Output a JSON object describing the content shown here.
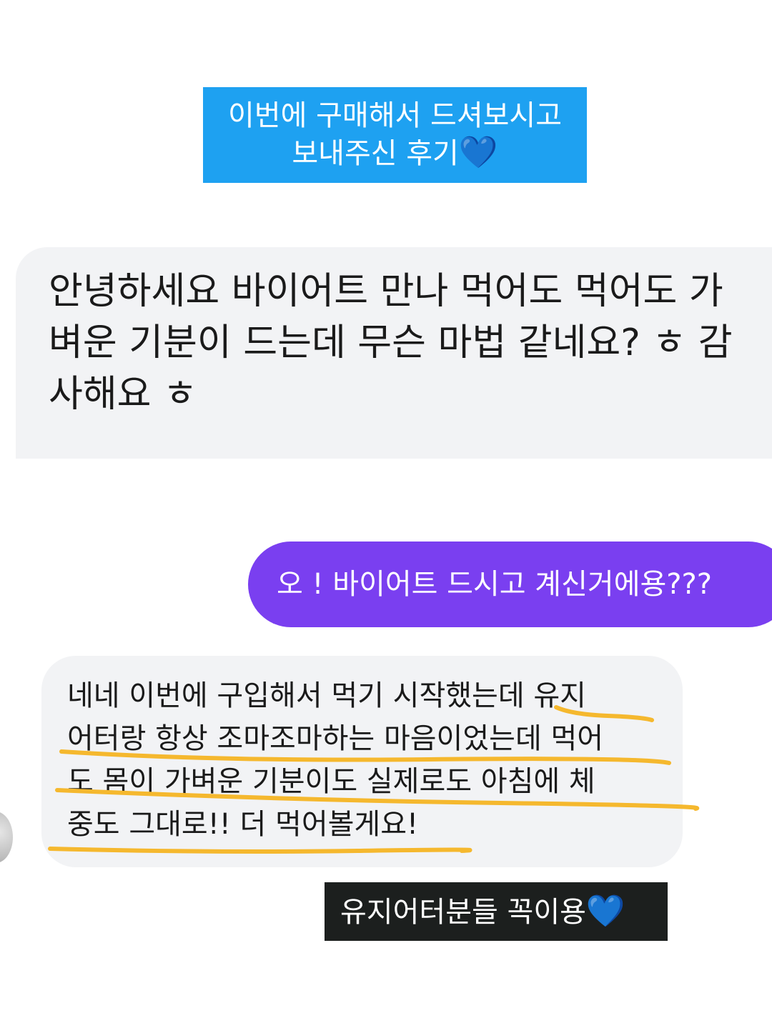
{
  "top_caption": {
    "line1": "이번에 구매해서 드셔보시고",
    "line2": "보내주신 후기",
    "emoji": "💙",
    "background": "#1ea1f1"
  },
  "messages": [
    {
      "direction": "incoming",
      "lines": [
        "안녕하세요 바이어트 만나 먹어도 먹어도 가",
        "벼운 기분이 드는데 무슨 마법 같네요? ㅎ 감",
        "사해요 ㅎ"
      ]
    },
    {
      "direction": "outgoing",
      "text": "오 ! 바이어트 드시고 계신거에용???",
      "background": "#7a3ff0"
    },
    {
      "direction": "incoming",
      "lines": [
        "네네 이번에 구입해서 먹기 시작했는데 유지",
        "어터랑 항상 조마조마하는 마음이었는데 먹어",
        "도 몸이 가벼운 기분이도 실제로도 아침에 체",
        "중도 그대로!! 더 먹어볼게요!"
      ]
    }
  ],
  "bottom_caption": {
    "text": "유지어터분들 꼭이용",
    "emoji": "💙",
    "background": "#1c1f1e"
  },
  "colors": {
    "incoming_bubble": "#f2f3f5",
    "highlight": "#f5b82e"
  }
}
